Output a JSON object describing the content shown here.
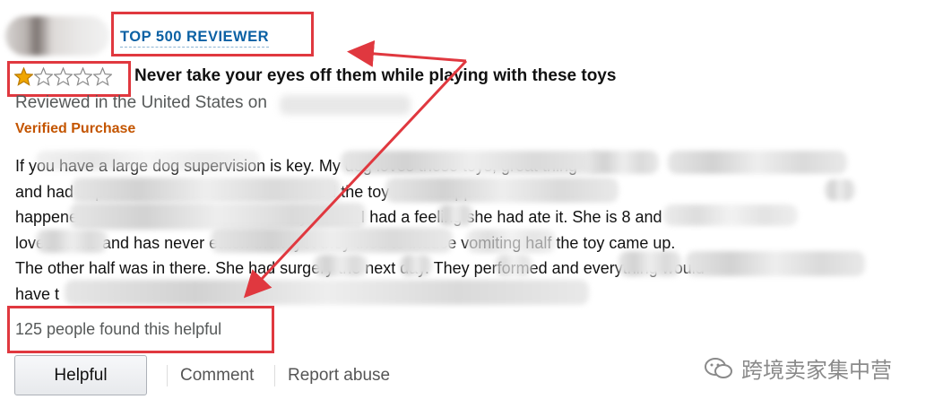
{
  "reviewer": {
    "badge": "TOP 500 REVIEWER"
  },
  "review": {
    "rating": 1,
    "rating_max": 5,
    "title": "Never take your eyes off them while playing with these toys",
    "reviewed_prefix": "Reviewed in the United States on",
    "verified": "Verified Purchase",
    "body_lines": [
      "If you have a large dog supervision is key. My dog loves these toys, great thing",
      "and had supervision. However when I looked the toy had disappeared it was all",
      "happened before I looked. I looked everywhere. I had a feeling she had ate it. She is 8 and",
      "loves sticks and has never eaten them yet they tried to induce vomiting half the toy came up.",
      "The other half was in there. She had surgery the next day. They performed and everything would",
      "have t"
    ],
    "helpful_count": "125 people found this helpful"
  },
  "actions": {
    "helpful": "Helpful",
    "comment": "Comment",
    "report": "Report abuse"
  },
  "watermark": {
    "text": "跨境卖家集中营",
    "icon": "wechat-icon"
  },
  "colors": {
    "annotation_red": "#e0383f",
    "badge_blue": "#0b61a4",
    "verified_orange": "#c45500",
    "star_gold": "#f0a600"
  }
}
